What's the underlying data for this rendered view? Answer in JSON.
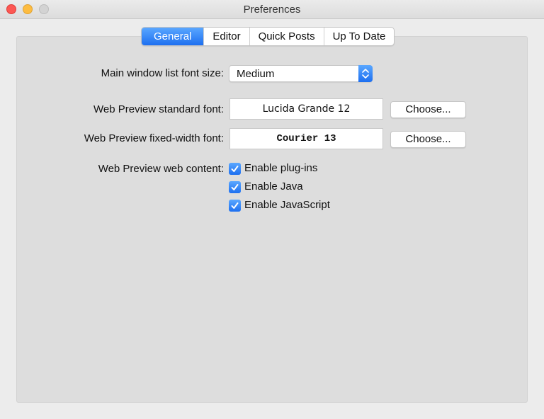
{
  "window": {
    "title": "Preferences"
  },
  "tabs": [
    {
      "label": "General",
      "active": true
    },
    {
      "label": "Editor",
      "active": false
    },
    {
      "label": "Quick Posts",
      "active": false
    },
    {
      "label": "Up To Date",
      "active": false
    }
  ],
  "general": {
    "list_font_size_label": "Main window list font size:",
    "list_font_size_value": "Medium",
    "standard_font_label": "Web Preview standard font:",
    "standard_font_value": "Lucida Grande 12",
    "fixed_font_label": "Web Preview fixed-width font:",
    "fixed_font_value": "Courier 13",
    "choose_label": "Choose...",
    "web_content_label": "Web Preview web content:",
    "options": [
      {
        "label": "Enable plug-ins",
        "checked": true
      },
      {
        "label": "Enable Java",
        "checked": true
      },
      {
        "label": "Enable JavaScript",
        "checked": true
      }
    ]
  },
  "colors": {
    "accent": "#2f7ff5",
    "close": "#fc5753",
    "minimize": "#fdbc40",
    "zoom": "#d3d3d3"
  }
}
